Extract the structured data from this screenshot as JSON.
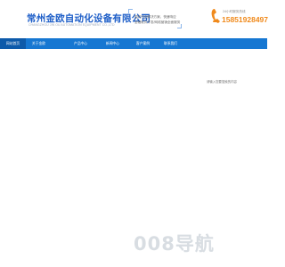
{
  "header": {
    "company_name": "常州金欧自动化设备有限公司",
    "company_name_en": "CHANGZHOU JIN OU AUTOMATION EQUIPMENT CO.,LTD",
    "service_lines": [
      "国内行业解决方案，快速响应",
      "全程软件开发/网络营销全面服务"
    ],
    "phone_label": "24小时服务热线",
    "phone_number": "15851928497"
  },
  "nav": {
    "items": [
      {
        "label": "网站首页",
        "active": true
      },
      {
        "label": "关于金欧",
        "active": false
      },
      {
        "label": "产品中心",
        "active": false
      },
      {
        "label": "新闻中心",
        "active": false
      },
      {
        "label": "客户案例",
        "active": false
      },
      {
        "label": "联系我们",
        "active": false
      }
    ],
    "search_placeholder": "请输入您要搜索的内容"
  },
  "footer": {
    "brand": "008导航"
  },
  "colors": {
    "nav_bg": "#1677d2",
    "nav_active": "#0d5aaa",
    "title": "#1f5fc8",
    "phone": "#f08a1c"
  }
}
